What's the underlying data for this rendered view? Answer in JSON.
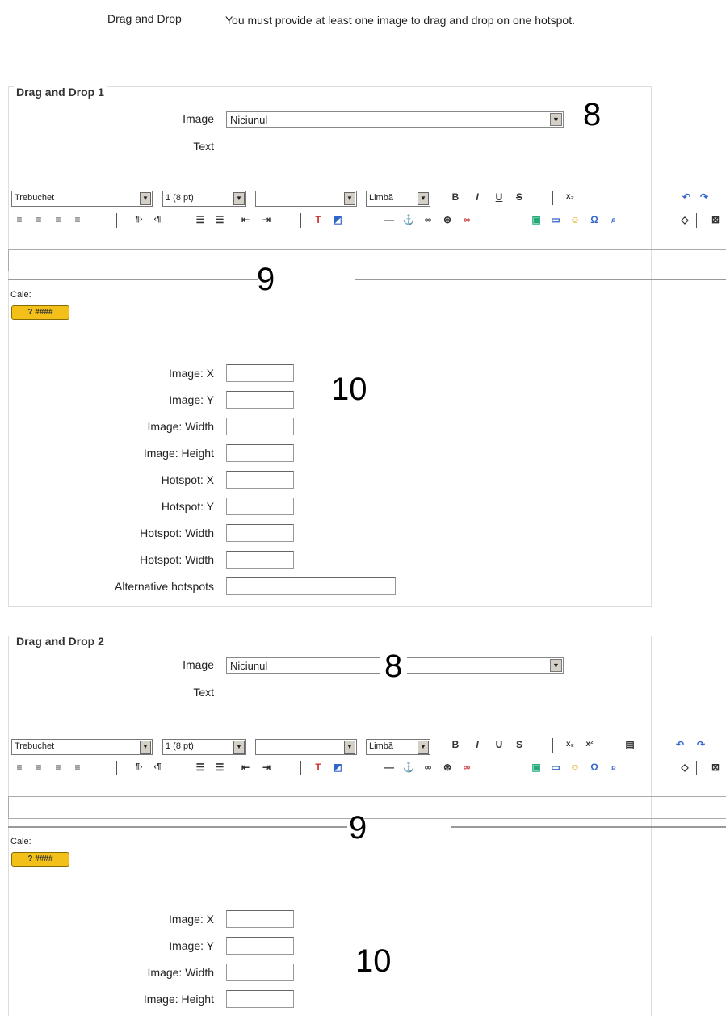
{
  "intro": {
    "label": "Drag and Drop",
    "text": "You must provide at least one image to drag and drop on one hotspot."
  },
  "sections": [
    {
      "title": "Drag and Drop 1",
      "image_label": "Image",
      "image_value": "Niciunul",
      "text_label": "Text",
      "annotation_image": "8",
      "annotation_editor": "9",
      "annotation_fields": "10",
      "toolbar": {
        "font": "Trebuchet",
        "size": "1 (8 pt)",
        "style": "",
        "lang": "Limbă"
      },
      "path_label": "Cale:",
      "fields": [
        {
          "label": "Image: X",
          "value": ""
        },
        {
          "label": "Image: Y",
          "value": ""
        },
        {
          "label": "Image: Width",
          "value": ""
        },
        {
          "label": "Image: Height",
          "value": ""
        },
        {
          "label": "Hotspot: X",
          "value": ""
        },
        {
          "label": "Hotspot: Y",
          "value": ""
        },
        {
          "label": "Hotspot: Width",
          "value": ""
        },
        {
          "label": "Hotspot: Width",
          "value": ""
        },
        {
          "label": "Alternative hotspots",
          "value": ""
        }
      ]
    },
    {
      "title": "Drag and Drop 2",
      "image_label": "Image",
      "image_value": "Niciunul",
      "text_label": "Text",
      "annotation_image": "8",
      "annotation_editor": "9",
      "annotation_fields": "10",
      "toolbar": {
        "font": "Trebuchet",
        "size": "1 (8 pt)",
        "style": "",
        "lang": "Limbă"
      },
      "path_label": "Cale:",
      "fields": [
        {
          "label": "Image: X",
          "value": ""
        },
        {
          "label": "Image: Y",
          "value": ""
        },
        {
          "label": "Image: Width",
          "value": ""
        },
        {
          "label": "Image: Height",
          "value": ""
        }
      ]
    }
  ],
  "icons": [
    "bold-icon",
    "italic-icon",
    "underline-icon",
    "strikethrough-icon",
    "subscript-icon",
    "superscript-icon",
    "clean-word-icon",
    "undo-icon",
    "redo-icon",
    "align-left-icon",
    "align-center-icon",
    "align-right-icon",
    "justify-icon",
    "ltr-icon",
    "rtl-icon",
    "ordered-list-icon",
    "unordered-list-icon",
    "outdent-icon",
    "indent-icon",
    "text-color-icon",
    "bg-color-icon",
    "horizontal-rule-icon",
    "anchor-icon",
    "link-icon",
    "unlink-icon",
    "nolink-icon",
    "image-icon",
    "table-icon",
    "smiley-icon",
    "special-char-icon",
    "search-replace-icon",
    "html-source-icon",
    "fullscreen-icon"
  ]
}
